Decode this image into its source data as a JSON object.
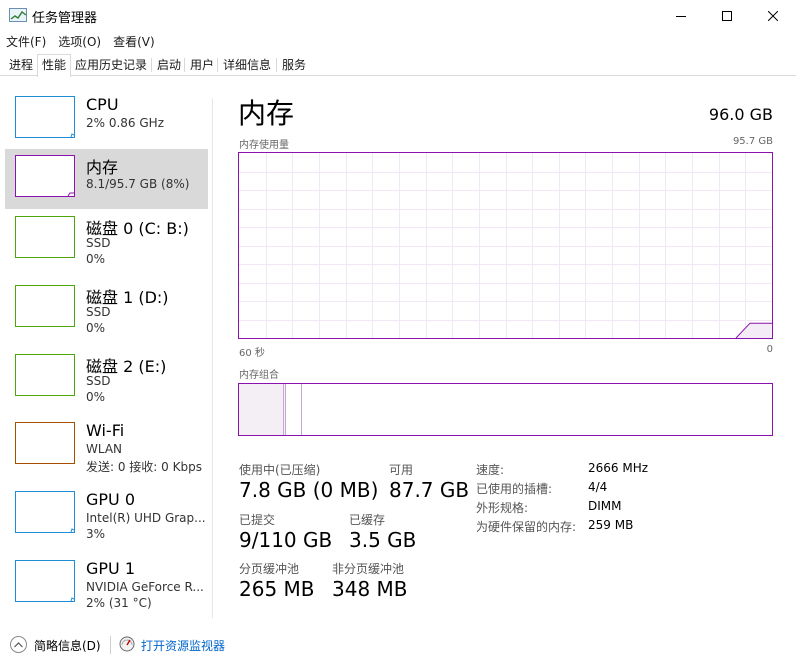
{
  "window": {
    "title": "任务管理器",
    "icon": "task-manager-icon",
    "minimize_icon": "minimize-icon",
    "maximize_icon": "maximize-icon",
    "close_icon": "close-icon"
  },
  "menu": [
    {
      "label": "文件(F)"
    },
    {
      "label": "选项(O)"
    },
    {
      "label": "查看(V)"
    }
  ],
  "tabs": [
    {
      "label": "进程",
      "active": false
    },
    {
      "label": "性能",
      "active": true
    },
    {
      "label": "应用历史记录",
      "active": false
    },
    {
      "label": "启动",
      "active": false
    },
    {
      "label": "用户",
      "active": false
    },
    {
      "label": "详细信息",
      "active": false
    },
    {
      "label": "服务",
      "active": false
    }
  ],
  "sidebar": {
    "items": [
      {
        "title": "CPU",
        "lines": [
          "2%  0.86 GHz"
        ],
        "color": "#1f8dd6",
        "selected": false
      },
      {
        "title": "内存",
        "lines": [
          "8.1/95.7 GB (8%)"
        ],
        "color": "#8b12ae",
        "selected": true
      },
      {
        "title": "磁盘 0 (C: B:)",
        "lines": [
          "SSD",
          "0%"
        ],
        "color": "#4da60c",
        "selected": false
      },
      {
        "title": "磁盘 1 (D:)",
        "lines": [
          "SSD",
          "0%"
        ],
        "color": "#4da60c",
        "selected": false
      },
      {
        "title": "磁盘 2 (E:)",
        "lines": [
          "SSD",
          "0%"
        ],
        "color": "#4da60c",
        "selected": false
      },
      {
        "title": "Wi-Fi",
        "lines": [
          "WLAN",
          "发送: 0 接收: 0 Kbps"
        ],
        "color": "#a74f01",
        "selected": false
      },
      {
        "title": "GPU 0",
        "lines": [
          "Intel(R) UHD Grap...",
          "3%"
        ],
        "color": "#1f8dd6",
        "selected": false
      },
      {
        "title": "GPU 1",
        "lines": [
          "NVIDIA GeForce R...",
          "2% (31 °C)"
        ],
        "color": "#1f8dd6",
        "selected": false
      }
    ]
  },
  "main": {
    "title": "内存",
    "total": "96.0 GB",
    "graph_label": "内存使用量",
    "graph_max": "95.7 GB",
    "time_left": "60 秒",
    "time_right": "0",
    "composition_label": "内存组合",
    "accent_color": "#8b12ae",
    "usage_fraction": 0.08,
    "stats": {
      "in_use_label": "使用中(已压缩)",
      "in_use_value": "7.8 GB (0 MB)",
      "available_label": "可用",
      "available_value": "87.7 GB",
      "committed_label": "已提交",
      "committed_value": "9/110 GB",
      "cached_label": "已缓存",
      "cached_value": "3.5 GB",
      "paged_label": "分页缓冲池",
      "paged_value": "265 MB",
      "nonpaged_label": "非分页缓冲池",
      "nonpaged_value": "348 MB"
    },
    "details": [
      {
        "label": "速度:",
        "value": "2666 MHz"
      },
      {
        "label": "已使用的插槽:",
        "value": "4/4"
      },
      {
        "label": "外形规格:",
        "value": "DIMM"
      },
      {
        "label": "为硬件保留的内存:",
        "value": "259 MB"
      }
    ]
  },
  "footer": {
    "fewer_details": "简略信息(D)",
    "fewer_icon": "chevron-up-icon",
    "open_monitor": "打开资源监视器",
    "monitor_icon": "resource-monitor-icon"
  }
}
